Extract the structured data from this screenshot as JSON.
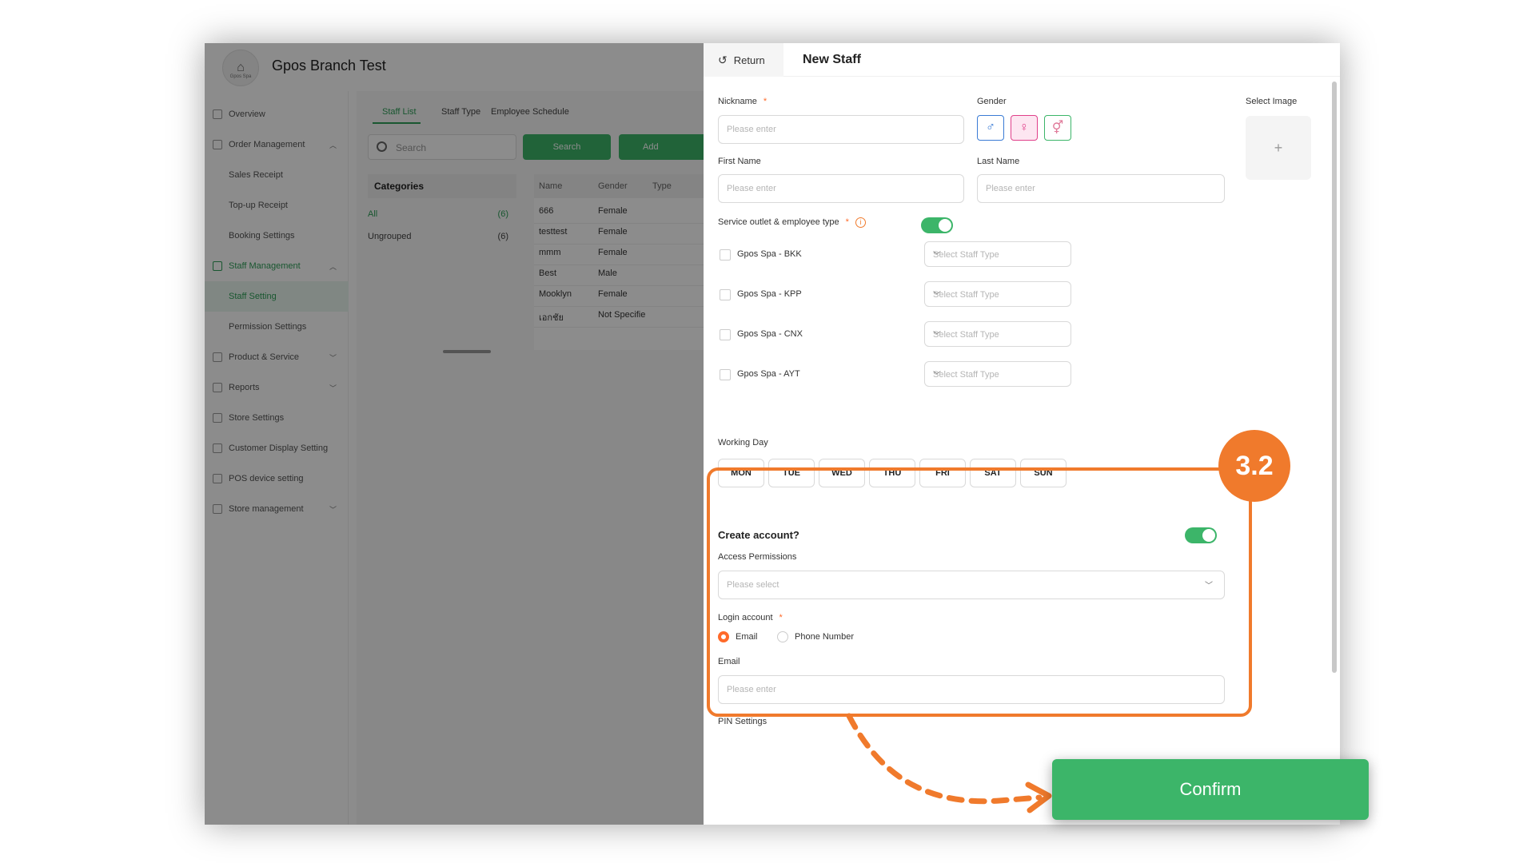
{
  "app": {
    "logo_text": "Gpos Spa",
    "branch_title": "Gpos Branch Test"
  },
  "sidebar": {
    "items": [
      {
        "label": "Overview"
      },
      {
        "label": "Order Management"
      },
      {
        "label": "Sales Receipt"
      },
      {
        "label": "Top-up Receipt"
      },
      {
        "label": "Booking Settings"
      },
      {
        "label": "Staff Management"
      },
      {
        "label": "Staff Setting"
      },
      {
        "label": "Permission Settings"
      },
      {
        "label": "Product & Service"
      },
      {
        "label": "Reports"
      },
      {
        "label": "Store Settings"
      },
      {
        "label": "Customer Display Setting"
      },
      {
        "label": "POS device setting"
      },
      {
        "label": "Store management"
      }
    ]
  },
  "staff_page": {
    "tabs": [
      "Staff List",
      "Staff Type",
      "Employee Schedule"
    ],
    "search_placeholder": "Search",
    "search_button": "Search",
    "add_button": "Add",
    "categories_title": "Categories",
    "categories": [
      {
        "name": "All",
        "count": "(6)"
      },
      {
        "name": "Ungrouped",
        "count": "(6)"
      }
    ],
    "table_headers": [
      "Name",
      "Gender",
      "Type"
    ],
    "rows": [
      {
        "name": "666",
        "gender": "Female"
      },
      {
        "name": "testtest",
        "gender": "Female"
      },
      {
        "name": "mmm",
        "gender": "Female"
      },
      {
        "name": "Best",
        "gender": "Male"
      },
      {
        "name": "Mooklyn",
        "gender": "Female"
      },
      {
        "name": "เอกชัย",
        "gender": "Not Specifie"
      }
    ]
  },
  "drawer": {
    "return_label": "Return",
    "title": "New Staff",
    "nickname_label": "Nickname",
    "gender_label": "Gender",
    "select_image_label": "Select Image",
    "select_image_plus": "+",
    "first_name_label": "First Name",
    "last_name_label": "Last Name",
    "placeholder_enter": "Please enter",
    "placeholder_select": "Please select",
    "required_mark": "*",
    "service_outlet_label": "Service outlet & employee type",
    "info_glyph": "i",
    "outlets": [
      {
        "name": "Gpos Spa - BKK",
        "select": "Select Staff Type"
      },
      {
        "name": "Gpos Spa - KPP",
        "select": "Select Staff Type"
      },
      {
        "name": "Gpos Spa - CNX",
        "select": "Select Staff Type"
      },
      {
        "name": "Gpos Spa - AYT",
        "select": "Select Staff Type"
      }
    ],
    "working_day_label": "Working Day",
    "days": [
      "MON",
      "TUE",
      "WED",
      "THU",
      "FRI",
      "SAT",
      "SUN"
    ],
    "create_account_label": "Create account?",
    "access_permissions_label": "Access Permissions",
    "login_account_label": "Login account",
    "login_options": [
      "Email",
      "Phone Number"
    ],
    "email_label": "Email",
    "pin_settings_label": "PIN Settings"
  },
  "overlay": {
    "step_badge": "3.2",
    "confirm_label": "Confirm"
  },
  "colors": {
    "accent_green": "#3cb569",
    "highlight_orange": "#f07a2c"
  }
}
